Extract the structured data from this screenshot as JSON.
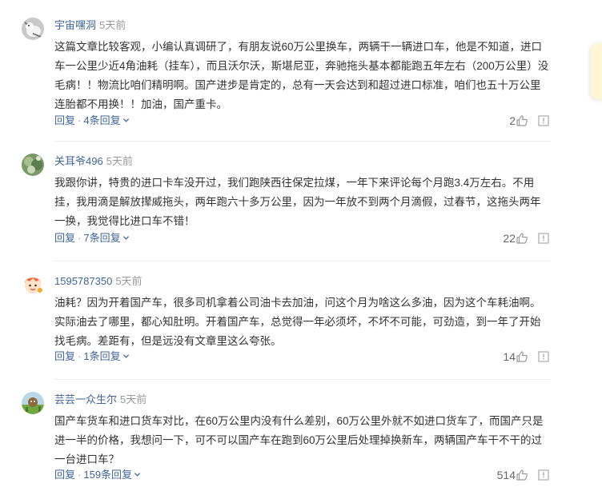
{
  "comments": [
    {
      "username": "宇宙嘿洞",
      "time": "5天前",
      "text": "这篇文章比较客观，小编认真调研了，有朋友说60万公里换车，两辆干一辆进口车，他是不知道，进口车一公里少近4角油耗（挂车），而且沃尔沃，斯堪尼亚，奔驰拖头基本都能跑五年左右（200万公里）没毛病！！物流比咱们精明啊。国产进步是肯定的，总有一天会达到和超过进口标准，咱们也五十万公里连胎都不用换！！加油，国产重卡。",
      "reply_label": "回复",
      "sub_replies": "4条回复",
      "likes": "2",
      "avatar_icon": "cat-avatar-icon"
    },
    {
      "username": "关耳爷496",
      "time": "5天前",
      "text": "我跟你讲，特贵的进口卡车没开过，我们跑陕西往保定拉煤，一年下来评论每个月跑3.4万左右。不用挂，我用滴是解放撵威拖头，两年跑六十多万公里，因为一年放不到两个月滴假，过春节，这拖头两年一换，我觉得比进口车不错！",
      "reply_label": "回复",
      "sub_replies": "7条回复",
      "likes": "22",
      "avatar_icon": "plant-avatar-icon"
    },
    {
      "username": "1595787350",
      "time": "5天前",
      "text": "油耗？因为开着国产车，很多司机拿着公司油卡去加油，问这个月为啥这么多油，因为这个车耗油啊。实际油去了哪里，都心知肚明。开着国产车，总觉得一年必须坏，不坏不可能，可劲造，到一年了开始找毛病。差距有，但是远没有文章里这么夸张。",
      "reply_label": "回复",
      "sub_replies": "1条回复",
      "likes": "14",
      "avatar_icon": "cartoon-avatar-icon"
    },
    {
      "username": "芸芸一众生尔",
      "time": "5天前",
      "text": "国产车货车和进口货车对比，在60万公里内没有什么差别，60万公里外就不如进口货车了，而国产只是进一半的价格，我想问一下，可不可以国产车在跑到60万公里后处理掉换新车，两辆国产车干不干的过一台进口车？",
      "reply_label": "回复",
      "sub_replies": "159条回复",
      "likes": "514",
      "avatar_icon": "landscape-avatar-icon"
    }
  ],
  "colors": {
    "username": "#406599",
    "text": "#333333",
    "muted": "#999999",
    "divider": "#eeeeee"
  }
}
